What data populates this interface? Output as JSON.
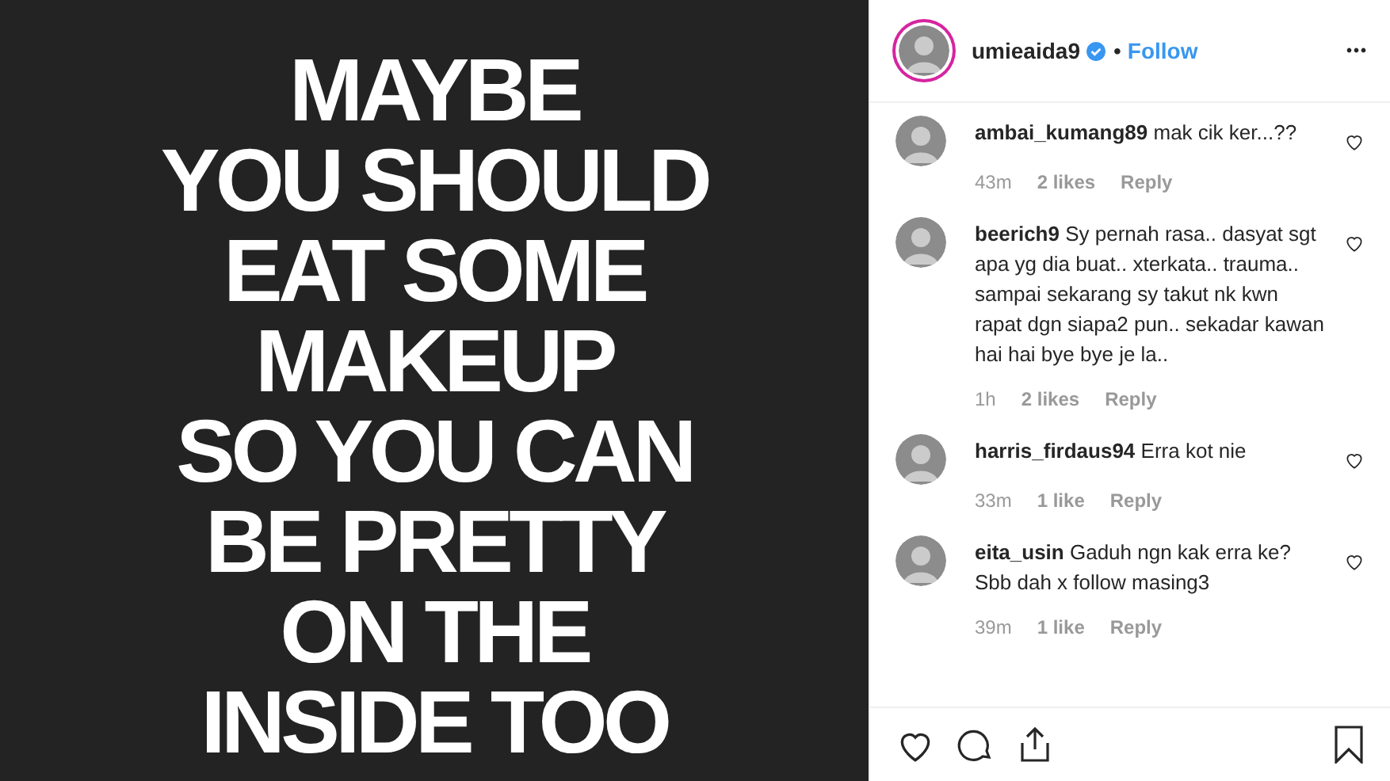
{
  "post_image": {
    "lines": [
      "MAYBE",
      "YOU SHOULD",
      "EAT SOME",
      "MAKEUP",
      "SO YOU CAN",
      "BE PRETTY",
      "ON THE",
      "INSIDE TOO"
    ]
  },
  "header": {
    "username": "umieaida9",
    "verified": true,
    "separator": "•",
    "follow": "Follow",
    "more": "•••"
  },
  "comments": [
    {
      "username": "ambai_kumang89",
      "text": "mak cik ker...??",
      "time": "43m",
      "likes": "2 likes",
      "reply": "Reply"
    },
    {
      "username": "beerich9",
      "text": "Sy pernah rasa.. dasyat sgt apa yg dia buat.. xterkata.. trauma.. sampai sekarang sy takut nk kwn rapat dgn siapa2 pun.. sekadar kawan hai hai bye bye je la..",
      "time": "1h",
      "likes": "2 likes",
      "reply": "Reply"
    },
    {
      "username": "harris_firdaus94",
      "text": "Erra kot nie",
      "time": "33m",
      "likes": "1 like",
      "reply": "Reply"
    },
    {
      "username": "eita_usin",
      "text": "Gaduh ngn kak erra ke? Sbb dah x follow masing3",
      "time": "39m",
      "likes": "1 like",
      "reply": "Reply"
    }
  ]
}
